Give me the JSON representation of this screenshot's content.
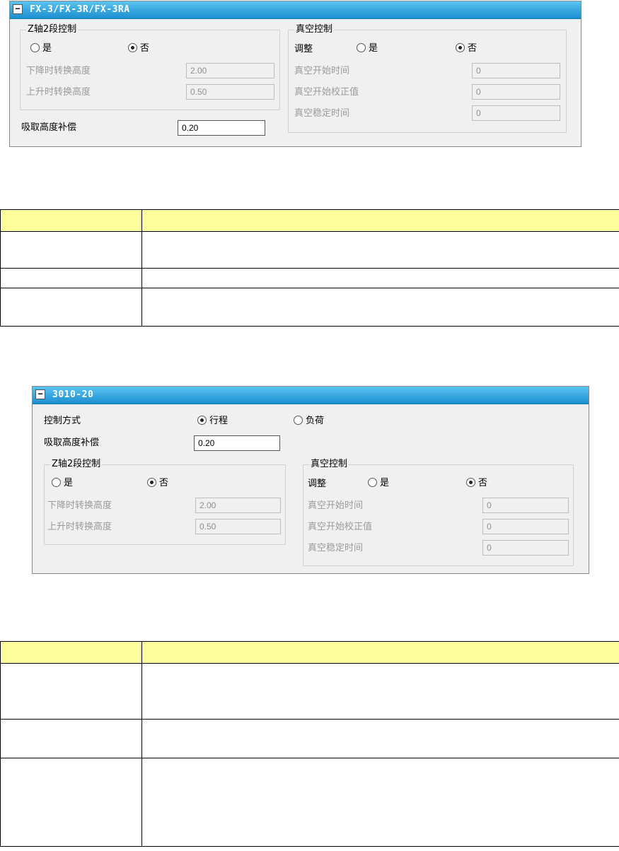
{
  "panel1": {
    "title": "FX-3/FX-3R/FX-3RA",
    "collapse": "−",
    "z_group": {
      "legend": "Z轴2段控制",
      "yes": "是",
      "no": "否",
      "down_label": "下降时转换高度",
      "down_value": "2.00",
      "up_label": "上升时转换高度",
      "up_value": "0.50"
    },
    "pick_label": "吸取高度补偿",
    "pick_value": "0.20",
    "vac_group": {
      "legend": "真空控制",
      "adjust": "调整",
      "yes": "是",
      "no": "否",
      "start_time_label": "真空开始时间",
      "start_time_value": "0",
      "start_cal_label": "真空开始校正值",
      "start_cal_value": "0",
      "stable_label": "真空稳定时间",
      "stable_value": "0"
    }
  },
  "panel2": {
    "title": "3010-20",
    "collapse": "−",
    "ctrl_label": "控制方式",
    "stroke": "行程",
    "load": "负荷",
    "pick_label": "吸取高度补偿",
    "pick_value": "0.20",
    "z_group": {
      "legend": "Z轴2段控制",
      "yes": "是",
      "no": "否",
      "down_label": "下降时转换高度",
      "down_value": "2.00",
      "up_label": "上升时转换高度",
      "up_value": "0.50"
    },
    "vac_group": {
      "legend": "真空控制",
      "adjust": "调整",
      "yes": "是",
      "no": "否",
      "start_time_label": "真空开始时间",
      "start_time_value": "0",
      "start_cal_label": "真空开始校正值",
      "start_cal_value": "0",
      "stable_label": "真空稳定时间",
      "stable_value": "0"
    }
  }
}
